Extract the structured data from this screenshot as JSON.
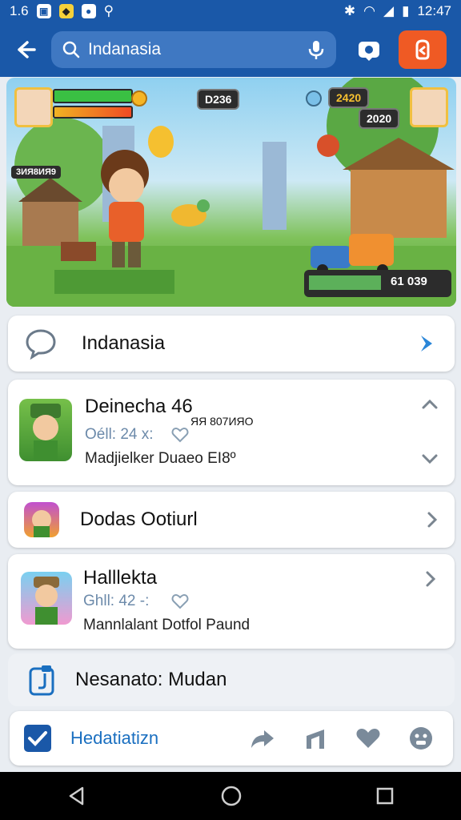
{
  "status_bar": {
    "time_left": "1.6",
    "time": "12:47"
  },
  "app_bar": {
    "search_value": "Indanasia"
  },
  "banner": {
    "hud_center": "D236",
    "hud_score": "2420",
    "hud_score2": "2020",
    "hud_bottom": "61 039",
    "left_label": "3ИЯ8ИЯ9"
  },
  "search_row": {
    "label": "Indanasia"
  },
  "items": [
    {
      "title": "Deinecha 46",
      "badge": "ЯЯ 807ИЯО",
      "sub": "Oéll: 24 x:",
      "desc": "Madjielker Duaeo EI8º"
    },
    {
      "title": "Dodas Ootiurl"
    },
    {
      "title": "Halllekta",
      "sub": "Ghll: 42 -:",
      "desc": "Mannlalant Dotfol Paund"
    }
  ],
  "notice": {
    "label": "Nesanato: Mudan"
  },
  "bottom_bar": {
    "label": "Hedatiatizn"
  },
  "colors": {
    "primary": "#1a58a8",
    "accent": "#ef5a24",
    "link": "#1a6fc0"
  }
}
